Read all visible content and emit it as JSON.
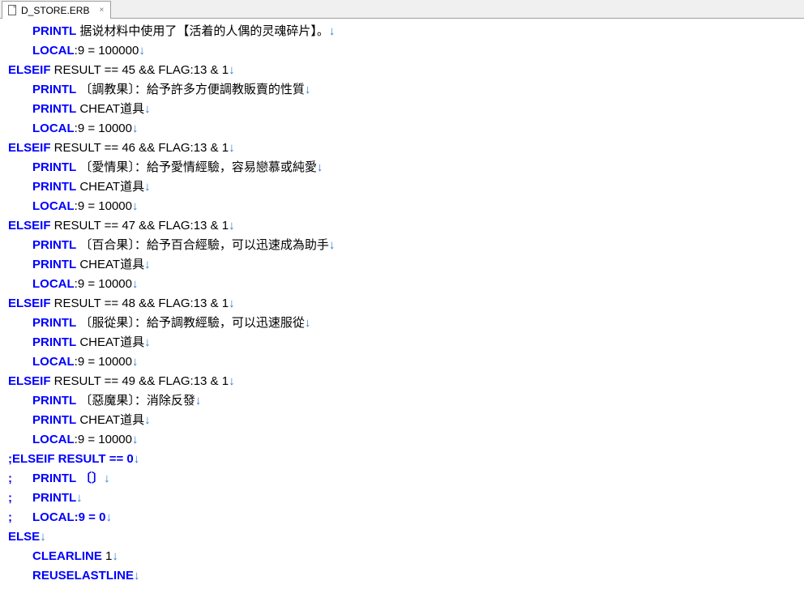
{
  "tab": {
    "filename": "D_STORE.ERB",
    "close": "×"
  },
  "lines": [
    {
      "level": 1,
      "kw": "PRINTL",
      "rest": " 据说材料中使用了【活着的人偶的灵魂碎片】。"
    },
    {
      "level": 1,
      "kw": "LOCAL",
      "rest": ":9 = 100000"
    },
    {
      "level": 0,
      "kw": "ELSEIF",
      "rest": " RESULT == 45 && FLAG:13 & 1"
    },
    {
      "level": 1,
      "kw": "PRINTL",
      "rest": " 〔調教果〕：給予許多方便調教販賣的性質"
    },
    {
      "level": 1,
      "kw": "PRINTL",
      "rest": " CHEAT道具"
    },
    {
      "level": 1,
      "kw": "LOCAL",
      "rest": ":9 = 10000"
    },
    {
      "level": 0,
      "kw": "ELSEIF",
      "rest": " RESULT == 46 && FLAG:13 & 1"
    },
    {
      "level": 1,
      "kw": "PRINTL",
      "rest": " 〔愛情果〕：給予愛情經驗，容易戀慕或純愛"
    },
    {
      "level": 1,
      "kw": "PRINTL",
      "rest": " CHEAT道具"
    },
    {
      "level": 1,
      "kw": "LOCAL",
      "rest": ":9 = 10000"
    },
    {
      "level": 0,
      "kw": "ELSEIF",
      "rest": " RESULT == 47 && FLAG:13 & 1"
    },
    {
      "level": 1,
      "kw": "PRINTL",
      "rest": " 〔百合果〕：給予百合經驗，可以迅速成為助手"
    },
    {
      "level": 1,
      "kw": "PRINTL",
      "rest": " CHEAT道具"
    },
    {
      "level": 1,
      "kw": "LOCAL",
      "rest": ":9 = 10000"
    },
    {
      "level": 0,
      "kw": "ELSEIF",
      "rest": " RESULT == 48 && FLAG:13 & 1"
    },
    {
      "level": 1,
      "kw": "PRINTL",
      "rest": " 〔服從果〕：給予調教經驗，可以迅速服從"
    },
    {
      "level": 1,
      "kw": "PRINTL",
      "rest": " CHEAT道具"
    },
    {
      "level": 1,
      "kw": "LOCAL",
      "rest": ":9 = 10000"
    },
    {
      "level": 0,
      "kw": "ELSEIF",
      "rest": " RESULT == 49 && FLAG:13 & 1"
    },
    {
      "level": 1,
      "kw": "PRINTL",
      "rest": " 〔惡魔果〕：消除反發"
    },
    {
      "level": 1,
      "kw": "PRINTL",
      "rest": " CHEAT道具"
    },
    {
      "level": 1,
      "kw": "LOCAL",
      "rest": ":9 = 10000"
    },
    {
      "level": 0,
      "kw": ";ELSEIF RESULT == 0",
      "rest": ""
    },
    {
      "level": 0,
      "kw": ";      PRINTL 〔〕",
      "rest": ""
    },
    {
      "level": 0,
      "kw": ";      PRINTL",
      "rest": ""
    },
    {
      "level": 0,
      "kw": ";      LOCAL:9 = 0",
      "rest": ""
    },
    {
      "level": 0,
      "kw": "ELSE",
      "rest": ""
    },
    {
      "level": 1,
      "kw": "CLEARLINE",
      "rest": " 1"
    },
    {
      "level": 1,
      "kw": "REUSELASTLINE",
      "rest": ""
    }
  ],
  "eol_glyph": "↓"
}
